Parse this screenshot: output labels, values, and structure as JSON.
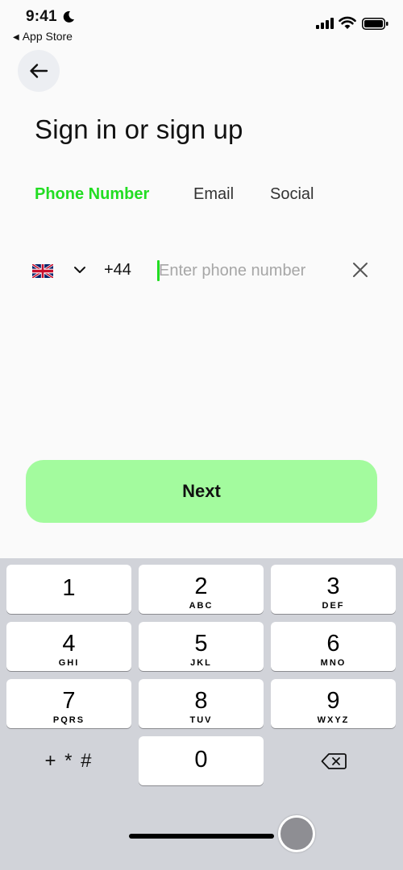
{
  "status_bar": {
    "time": "9:41",
    "back_app": "App Store",
    "icons": [
      "moon-icon",
      "cellular-signal-icon",
      "wifi-icon",
      "battery-icon"
    ]
  },
  "header": {
    "back_icon": "arrow-left-icon",
    "title": "Sign in or sign up"
  },
  "tabs": [
    {
      "label": "Phone Number",
      "active": true
    },
    {
      "label": "Email",
      "active": false
    },
    {
      "label": "Social",
      "active": false
    }
  ],
  "phone": {
    "flag_icon": "uk-flag-icon",
    "dropdown_icon": "chevron-down-icon",
    "country_code": "+44",
    "value": "",
    "placeholder": "Enter phone number",
    "clear_icon": "close-icon"
  },
  "next_button": {
    "label": "Next"
  },
  "keyboard": {
    "keys": [
      {
        "num": "1",
        "letters": ""
      },
      {
        "num": "2",
        "letters": "ABC"
      },
      {
        "num": "3",
        "letters": "DEF"
      },
      {
        "num": "4",
        "letters": "GHI"
      },
      {
        "num": "5",
        "letters": "JKL"
      },
      {
        "num": "6",
        "letters": "MNO"
      },
      {
        "num": "7",
        "letters": "PQRS"
      },
      {
        "num": "8",
        "letters": "TUV"
      },
      {
        "num": "9",
        "letters": "WXYZ"
      },
      {
        "num": "0",
        "letters": ""
      }
    ],
    "symbols_label": "+ * #",
    "delete_icon": "backspace-icon"
  },
  "colors": {
    "accent": "#22dd22",
    "button_bg": "#a3fb9e",
    "background": "#fafafa",
    "keyboard_bg": "#d1d3d9"
  }
}
